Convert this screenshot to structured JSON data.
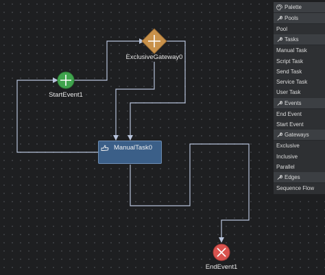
{
  "diagram": {
    "start_event": {
      "label": "StartEvent1",
      "color": "#3fa34d"
    },
    "gateway": {
      "label": "ExclusiveGateway0",
      "color": "#c8914a"
    },
    "task": {
      "label": "ManualTask0",
      "color": "#3b5f88",
      "icon": "hand-icon"
    },
    "end_event": {
      "label": "EndEvent1",
      "color": "#d9534f"
    },
    "edge_color": "#b8c4dc"
  },
  "palette": {
    "title": "Palette",
    "sections": [
      {
        "header": "Pools",
        "items": [
          "Pool"
        ]
      },
      {
        "header": "Tasks",
        "items": [
          "Manual Task",
          "Script Task",
          "Send Task",
          "Service Task",
          "User Task"
        ]
      },
      {
        "header": "Events",
        "items": [
          "End Event",
          "Start Event"
        ]
      },
      {
        "header": "Gateways",
        "items": [
          "Exclusive",
          "Inclusive",
          "Parallel"
        ]
      },
      {
        "header": "Edges",
        "items": [
          "Sequence Flow"
        ]
      }
    ]
  }
}
